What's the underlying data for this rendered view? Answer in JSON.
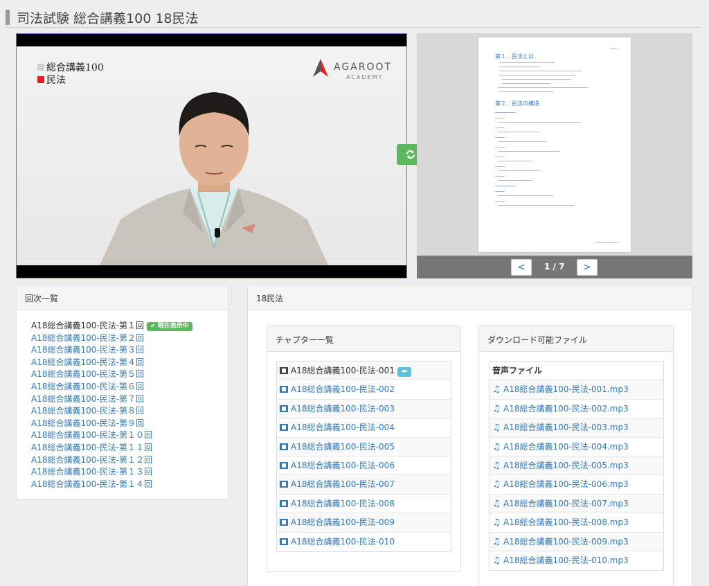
{
  "page": {
    "title": "司法試験 総合講義100 18民法"
  },
  "video": {
    "tag1": "総合講義100",
    "tag2": "民法",
    "logo_text": "AGAROOT",
    "logo_sub": "ACADEMY",
    "colors": {
      "tag1": "#cccccc",
      "tag2": "#e02020",
      "logo": "#e02020"
    }
  },
  "pdf": {
    "pager": "1 / 7",
    "prev_label": "<",
    "next_label": ">",
    "headings": [
      "第１．民法とは",
      "第２．民法の構造"
    ]
  },
  "episodes": {
    "header": "回次一覧",
    "current_badge": "現在表示中",
    "items": [
      "A18総合講義100-民法-第１回",
      "A18総合講義100-民法-第２回",
      "A18総合講義100-民法-第３回",
      "A18総合講義100-民法-第４回",
      "A18総合講義100-民法-第５回",
      "A18総合講義100-民法-第６回",
      "A18総合講義100-民法-第７回",
      "A18総合講義100-民法-第８回",
      "A18総合講義100-民法-第９回",
      "A18総合講義100-民法-第１０回",
      "A18総合講義100-民法-第１１回",
      "A18総合講義100-民法-第１２回",
      "A18総合講義100-民法-第１３回",
      "A18総合講義100-民法-第１４回"
    ]
  },
  "content": {
    "header": "18民法",
    "chapters": {
      "header": "チャプター一覧",
      "current_badge": "⬅",
      "items": [
        "A18総合講義100-民法-001",
        "A18総合講義100-民法-002",
        "A18総合講義100-民法-003",
        "A18総合講義100-民法-004",
        "A18総合講義100-民法-005",
        "A18総合講義100-民法-006",
        "A18総合講義100-民法-007",
        "A18総合講義100-民法-008",
        "A18総合講義100-民法-009",
        "A18総合講義100-民法-010"
      ]
    },
    "downloads": {
      "header": "ダウンロード可能ファイル",
      "table_header": "音声ファイル",
      "items": [
        "A18総合講義100-民法-001.mp3",
        "A18総合講義100-民法-002.mp3",
        "A18総合講義100-民法-003.mp3",
        "A18総合講義100-民法-004.mp3",
        "A18総合講義100-民法-005.mp3",
        "A18総合講義100-民法-006.mp3",
        "A18総合講義100-民法-007.mp3",
        "A18総合講義100-民法-008.mp3",
        "A18総合講義100-民法-009.mp3",
        "A18総合講義100-民法-010.mp3"
      ]
    }
  }
}
